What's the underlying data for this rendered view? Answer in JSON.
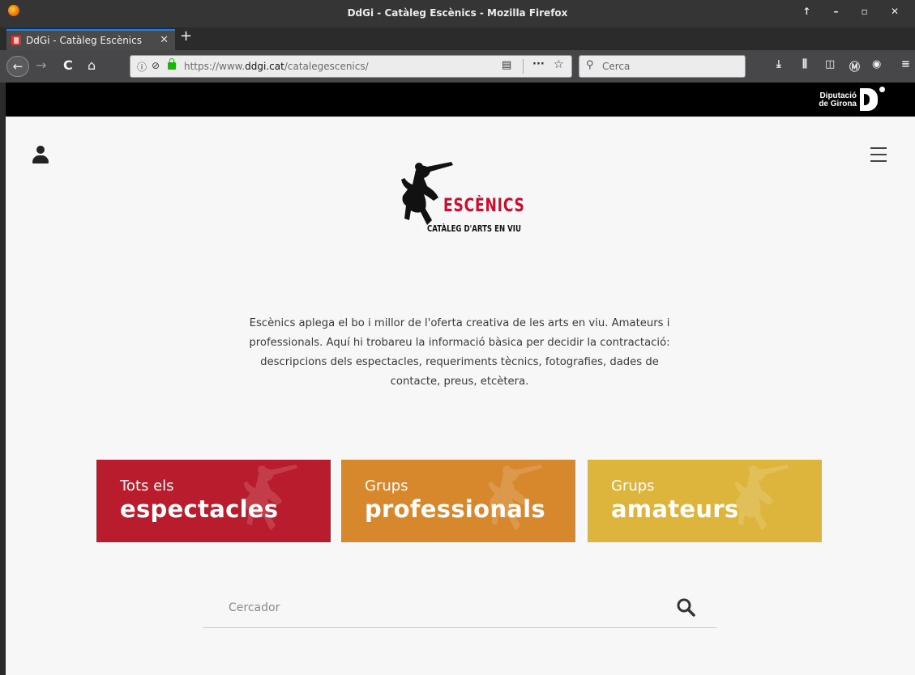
{
  "window": {
    "title": "DdGi - Catàleg Escènics - Mozilla Firefox",
    "controls": "↑ – ▫ ✕"
  },
  "tab": {
    "label": "DdGi - Catàleg Escènics",
    "close": "✕",
    "new_tab": "+"
  },
  "nav": {
    "back": "←",
    "forward": "→",
    "reload": "C",
    "home": "⌂",
    "url_prefix": "https://www.",
    "url_domain": "ddgi.cat",
    "url_path": "/catalegescenics/",
    "reader": "▤",
    "more": "···",
    "bookmark": "☆",
    "search_placeholder": "Cerca"
  },
  "toolbar_icons": {
    "download": "⤓",
    "library": "⫼",
    "sidebar": "◫",
    "extension": "Ⓜ",
    "account": "◉",
    "menu": "≡"
  },
  "banner": {
    "brand_line1": "Diputació",
    "brand_line2": "de Girona"
  },
  "logo": {
    "title": "ESCÈNICS",
    "subtitle": "CATÀLEG D'ARTS EN VIU"
  },
  "intro": {
    "text": "Escènics aplega el bo i millor de l'oferta creativa de les arts en viu. Amateurs i professionals. Aquí hi trobareu la informació bàsica per decidir la contractació: descripcions dels espectacles, requeriments tècnics, fotografies, dades de contacte, preus, etcètera."
  },
  "cards": [
    {
      "small": "Tots els",
      "big": "espectacles",
      "color": "#b91c2c"
    },
    {
      "small": "Grups",
      "big": "professionals",
      "color": "#d7882d"
    },
    {
      "small": "Grups",
      "big": "amateurs",
      "color": "#ddb53d"
    }
  ],
  "search": {
    "placeholder": "Cercador"
  }
}
